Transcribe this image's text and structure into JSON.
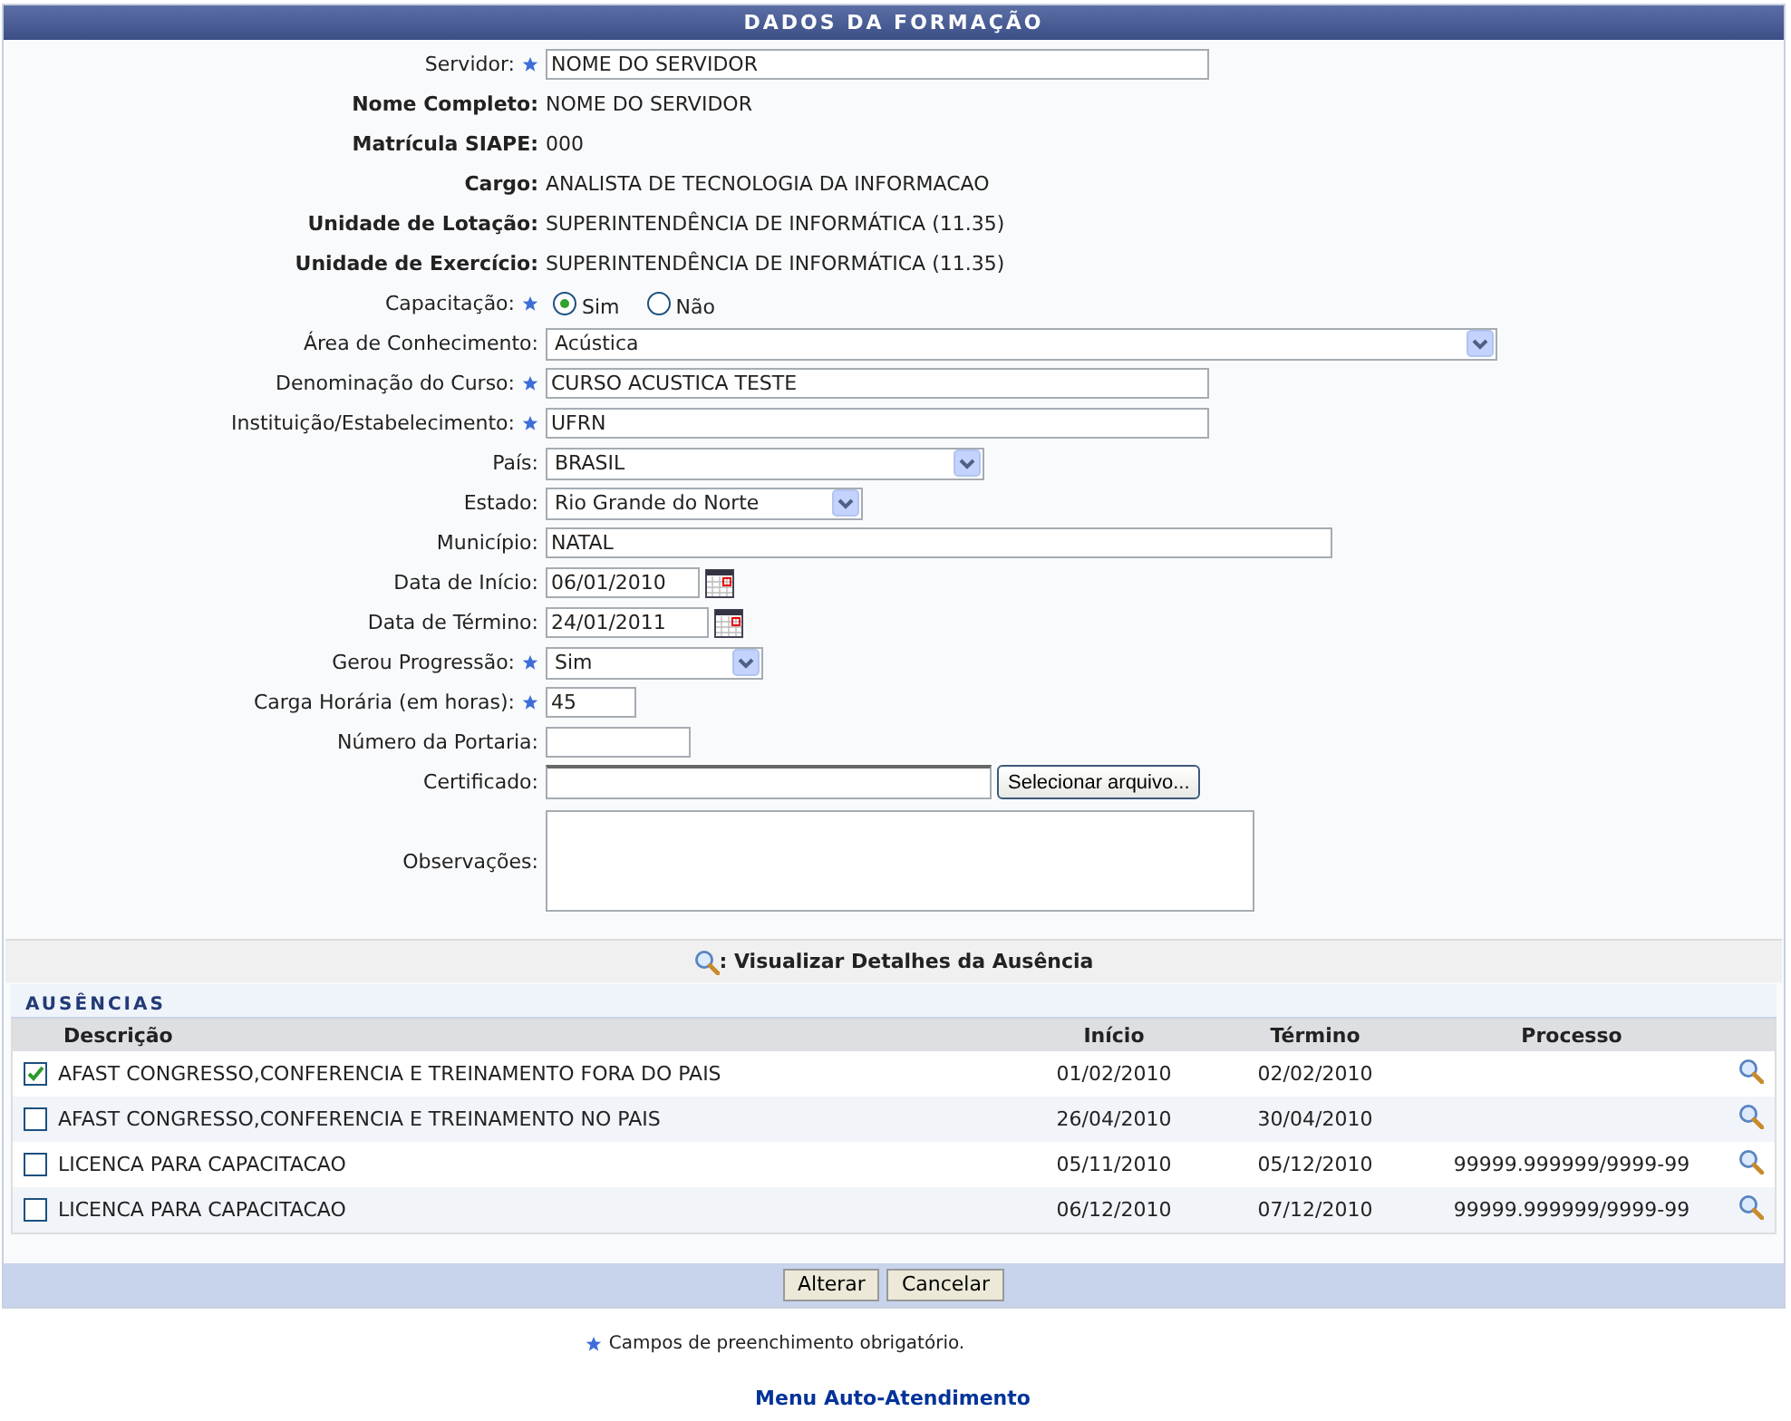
{
  "title": "DADOS DA FORMAÇÃO",
  "fields": [
    {
      "kind": "text",
      "label": "Servidor:",
      "required": true,
      "value": "NOME DO SERVIDOR"
    },
    {
      "kind": "static",
      "label": "Nome Completo:",
      "value": "NOME DO SERVIDOR"
    },
    {
      "kind": "static",
      "label": "Matrícula SIAPE:",
      "value": "000"
    },
    {
      "kind": "static",
      "label": "Cargo:",
      "value": "ANALISTA DE TECNOLOGIA DA INFORMACAO"
    },
    {
      "kind": "static",
      "label": "Unidade de Lotação:",
      "value": "SUPERINTENDÊNCIA DE INFORMÁTICA (11.35)"
    },
    {
      "kind": "static",
      "label": "Unidade de Exercício:",
      "value": "SUPERINTENDÊNCIA DE INFORMÁTICA (11.35)"
    },
    {
      "kind": "radio",
      "label": "Capacitação:",
      "required": true,
      "options": [
        {
          "label": "Sim",
          "selected": true
        },
        {
          "label": "Não",
          "selected": false
        }
      ]
    },
    {
      "kind": "select",
      "label": "Área de Conhecimento:",
      "required": false,
      "value": "Acústica"
    },
    {
      "kind": "text",
      "label": "Denominação do Curso:",
      "required": true,
      "value": "CURSO ACUSTICA TESTE"
    },
    {
      "kind": "text",
      "label": "Instituição/Estabelecimento:",
      "required": true,
      "value": "UFRN"
    },
    {
      "kind": "select",
      "label": "País:",
      "required": false,
      "value": "BRASIL"
    },
    {
      "kind": "select",
      "label": "Estado:",
      "required": false,
      "value": "Rio Grande do Norte"
    },
    {
      "kind": "text",
      "label": "Município:",
      "required": false,
      "value": "NATAL"
    },
    {
      "kind": "date",
      "label": "Data de Início:",
      "required": false,
      "value": "06/01/2010"
    },
    {
      "kind": "date",
      "label": "Data de Término:",
      "required": false,
      "value": "24/01/2011"
    },
    {
      "kind": "select",
      "label": "Gerou Progressão:",
      "required": true,
      "value": "Sim"
    },
    {
      "kind": "text",
      "label": "Carga Horária (em horas):",
      "required": true,
      "value": "45"
    },
    {
      "kind": "text",
      "label": "Número da Portaria:",
      "required": false
    },
    {
      "kind": "file",
      "label": "Certificado:",
      "required": false,
      "button": "Selecionar arquivo..."
    },
    {
      "kind": "textarea",
      "label": "Observações:",
      "required": false
    }
  ],
  "legend": ": Visualizar Detalhes da Ausência",
  "absences": {
    "title": "AUSÊNCIAS",
    "columns": [
      "Descrição",
      "Início",
      "Término",
      "Processo"
    ],
    "rows": [
      {
        "checked": true,
        "description": "AFAST CONGRESSO,CONFERENCIA E TREINAMENTO FORA DO PAIS",
        "start": "01/02/2010",
        "end": "02/02/2010"
      },
      {
        "checked": false,
        "description": "AFAST CONGRESSO,CONFERENCIA E TREINAMENTO NO PAIS",
        "start": "26/04/2010",
        "end": "30/04/2010"
      },
      {
        "checked": false,
        "description": "LICENCA PARA CAPACITACAO",
        "start": "05/11/2010",
        "end": "05/12/2010",
        "process": "99999.999999/9999-99"
      },
      {
        "checked": false,
        "description": "LICENCA PARA CAPACITACAO",
        "start": "06/12/2010",
        "end": "07/12/2010",
        "process": "99999.999999/9999-99"
      }
    ]
  },
  "buttons": [
    "Alterar",
    "Cancelar"
  ],
  "required_note": "Campos de preenchimento obrigatório.",
  "menu_link": "Menu Auto-Atendimento"
}
